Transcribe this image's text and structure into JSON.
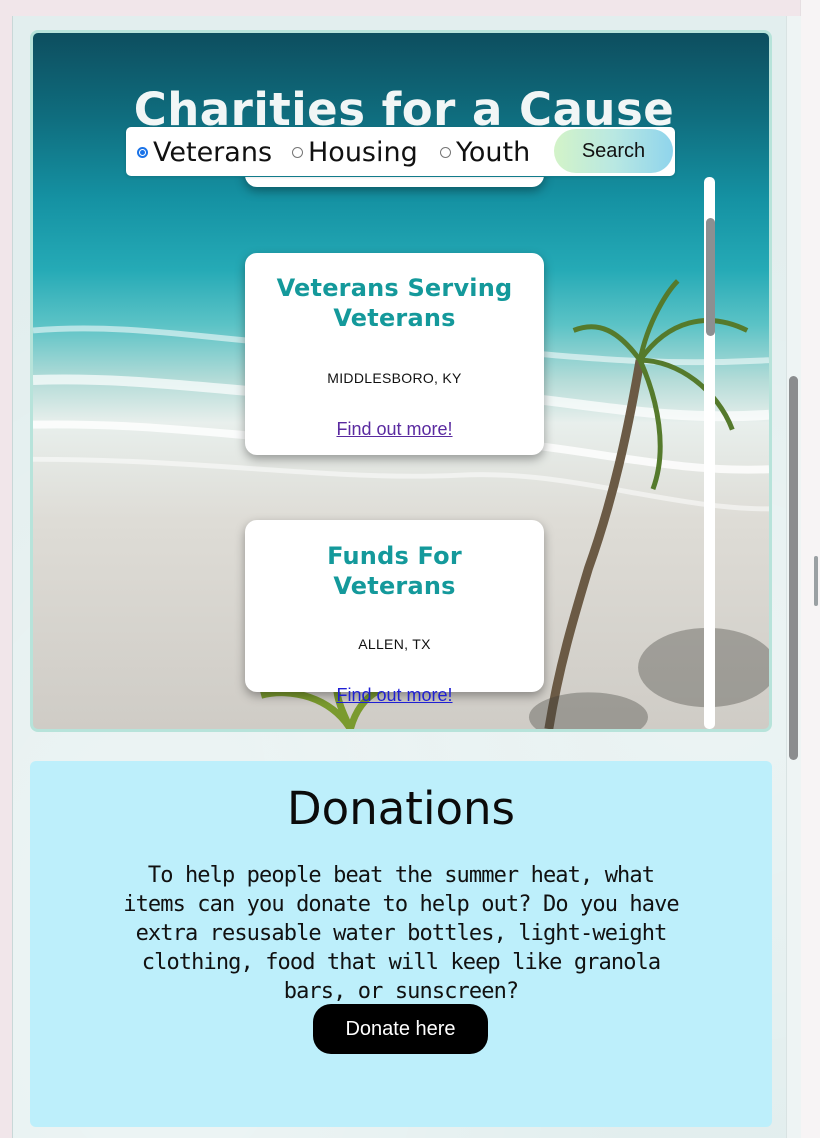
{
  "hero": {
    "title": "Charities for a Cause"
  },
  "filters": {
    "options": [
      {
        "label": "Veterans",
        "checked": true
      },
      {
        "label": "Housing",
        "checked": false
      },
      {
        "label": "Youth",
        "checked": false
      }
    ],
    "search_label": "Search"
  },
  "charities": [
    {
      "name": "Veterans Serving Veterans",
      "location": "MIDDLESBORO, KY",
      "link_text": "Find out more!",
      "link_visited": true
    },
    {
      "name": "Funds For Veterans",
      "location": "ALLEN, TX",
      "link_text": "Find out more!",
      "link_visited": false
    }
  ],
  "donations": {
    "title": "Donations",
    "text": "To help people beat the summer heat, what items can you donate to help out? Do you have extra resusable water bottles, light-weight clothing, food that will keep like granola bars, or sunscreen?",
    "button_label": "Donate here"
  },
  "colors": {
    "accent_teal": "#14999b",
    "donations_bg": "#bdeffb",
    "visited_link": "#5a2aa0",
    "link": "#1f1fd4",
    "radio_checked": "#1a73e8"
  }
}
